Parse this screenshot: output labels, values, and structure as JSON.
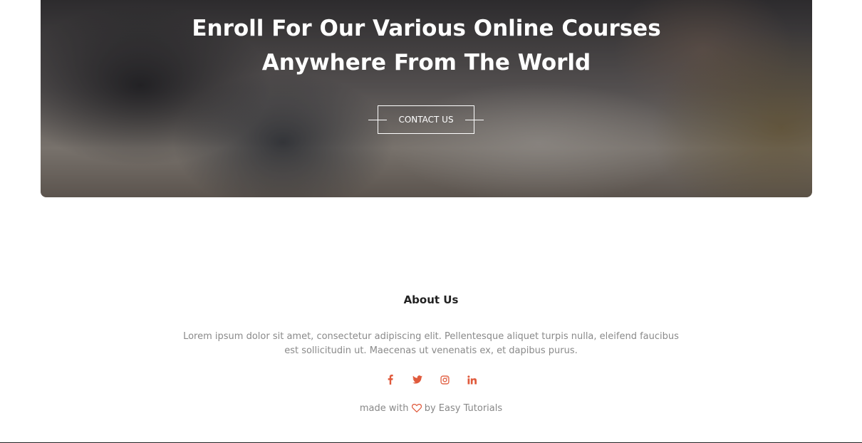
{
  "cta": {
    "title_line1": "Enroll For Our Various Online Courses",
    "title_line2": "Anywhere From The World",
    "button_label": "CONTACT US"
  },
  "about": {
    "title": "About Us",
    "text": "Lorem ipsum dolor sit amet, consectetur adipiscing elit. Pellentesque aliquet turpis nulla, eleifend faucibus est sollicitudin ut. Maecenas ut venenatis ex, et dapibus purus."
  },
  "socials": [
    {
      "icon": "facebook-icon"
    },
    {
      "icon": "twitter-icon"
    },
    {
      "icon": "instagram-icon"
    },
    {
      "icon": "linkedin-icon"
    }
  ],
  "footer": {
    "made_prefix": "made with",
    "made_suffix": "by Easy Tutorials"
  },
  "colors": {
    "accent": "#e05a3c",
    "heart": "#e05a3c"
  }
}
